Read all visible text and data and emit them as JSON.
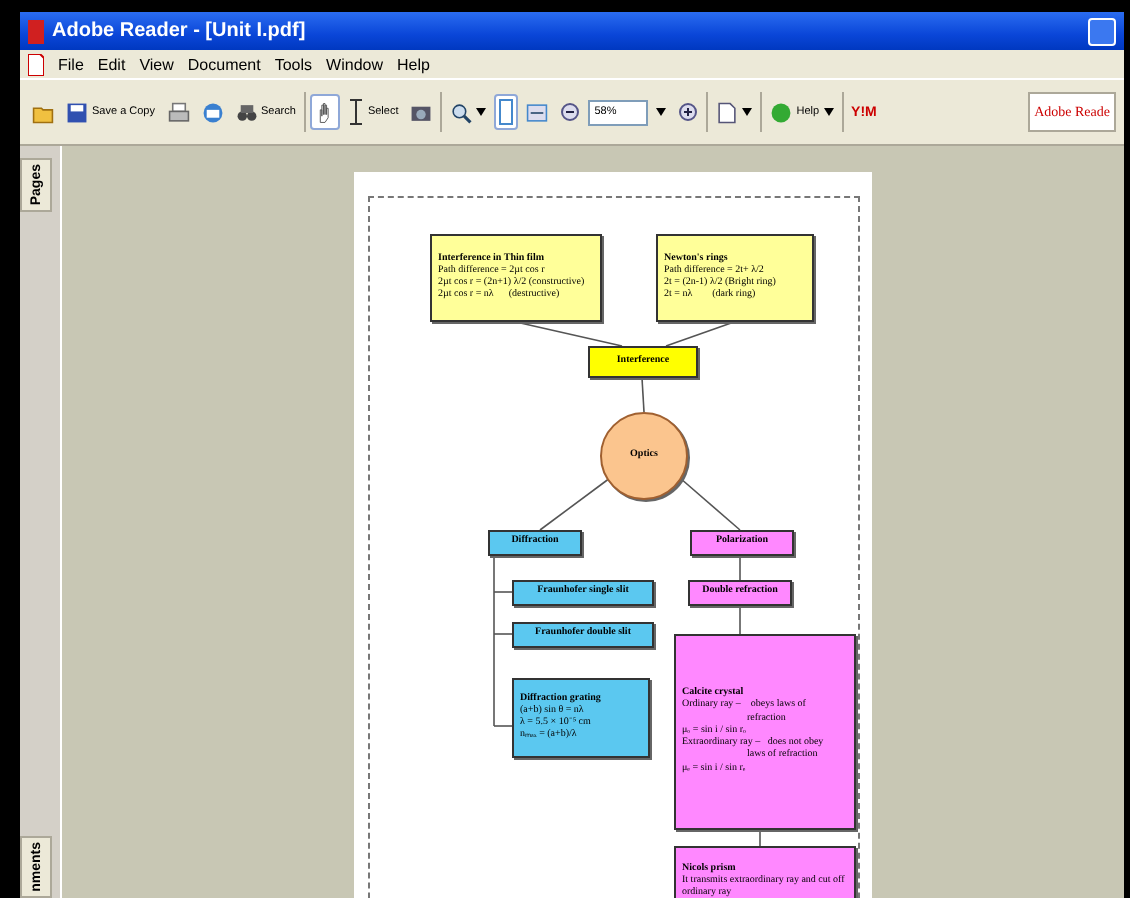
{
  "window": {
    "title": "Adobe Reader - [Unit I.pdf]"
  },
  "menu": [
    "File",
    "Edit",
    "View",
    "Document",
    "Tools",
    "Window",
    "Help"
  ],
  "toolbar": [
    {
      "kind": "icon"
    },
    {
      "kind": "button",
      "label": "Save a Copy"
    },
    {
      "kind": "icon"
    },
    {
      "kind": "icon"
    },
    {
      "kind": "button",
      "label": "Search"
    },
    {
      "kind": "sep"
    },
    {
      "kind": "toggle",
      "selected": true
    },
    {
      "kind": "button",
      "label": "Select"
    },
    {
      "kind": "icon"
    },
    {
      "kind": "sep"
    },
    {
      "kind": "drop"
    },
    {
      "kind": "toggle",
      "selected": true
    },
    {
      "kind": "icon"
    },
    {
      "kind": "icon"
    },
    {
      "kind": "field",
      "value": "58%"
    },
    {
      "kind": "drop"
    },
    {
      "kind": "icon"
    },
    {
      "kind": "sep"
    },
    {
      "kind": "drop"
    },
    {
      "kind": "sep"
    },
    {
      "kind": "drop",
      "label": "Help"
    },
    {
      "kind": "sep"
    },
    {
      "kind": "yahoo",
      "label": "Y!M"
    }
  ],
  "logo": {
    "label": "Adobe Reade"
  },
  "side_tabs": [
    {
      "label": "Pages"
    },
    {
      "label": "nments"
    }
  ],
  "diagram": {
    "nodes": [
      {
        "kind": "card",
        "color": "#ffff99",
        "lines": [
          "Interference in Thin film",
          "Path difference = 2µt cos r",
          "2µt cos r = (2n+1) λ/2 (constructive)",
          "2µt cos r = nλ      (destructive)"
        ]
      },
      {
        "kind": "card",
        "color": "#ffff99",
        "lines": [
          "Newton's rings",
          "Path difference = 2t+ λ/2",
          "2t = (2n-1) λ/2 (Bright ring)",
          "2t = nλ        (dark ring)"
        ]
      },
      {
        "kind": "label",
        "color": "#ffff00",
        "lines": [
          "Interference"
        ]
      },
      {
        "kind": "circle",
        "color": "#fbc58e",
        "lines": [
          "Optics"
        ]
      },
      {
        "kind": "label",
        "color": "#5bc8f0",
        "lines": [
          "Diffraction"
        ]
      },
      {
        "kind": "label",
        "color": "#ff88ff",
        "lines": [
          "Polarization"
        ]
      },
      {
        "kind": "label",
        "color": "#5bc8f0",
        "lines": [
          "Fraunhofer single slit"
        ]
      },
      {
        "kind": "label",
        "color": "#5bc8f0",
        "lines": [
          "Fraunhofer double slit"
        ]
      },
      {
        "kind": "card",
        "color": "#5bc8f0",
        "lines": [
          "Diffraction grating",
          "(a+b) sin θ = nλ",
          "λ = 5.5 × 10⁻⁵ cm",
          "nₘₐₓ = (a+b)/λ"
        ]
      },
      {
        "kind": "label",
        "color": "#ff88ff",
        "lines": [
          "Double refraction"
        ]
      },
      {
        "kind": "card",
        "color": "#ff88ff",
        "lines": [
          "Calcite crystal",
          "Ordinary ray –    obeys laws of",
          "                          refraction",
          "μₒ = sin i / sin rₒ",
          "Extraordinary ray –   does not obey",
          "                          laws of refraction",
          "μₑ = sin i / sin rₑ"
        ]
      },
      {
        "kind": "card",
        "color": "#ff88ff",
        "lines": [
          "Nicols prism",
          "It transmits extraordinary ray and cut off",
          "ordinary ray"
        ]
      }
    ]
  }
}
